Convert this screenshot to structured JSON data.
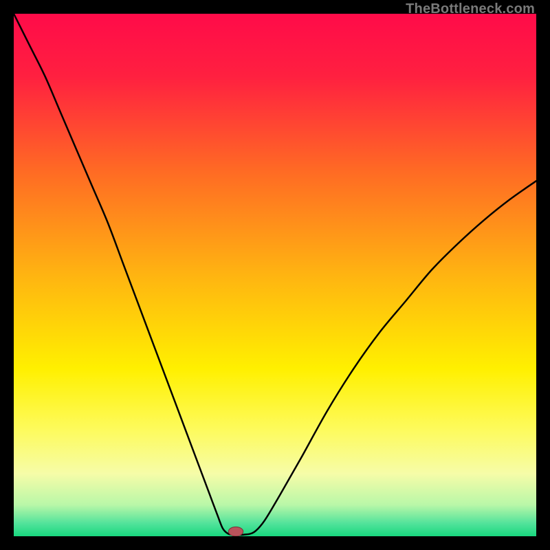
{
  "watermark": "TheBottleneck.com",
  "chart_data": {
    "type": "line",
    "title": "",
    "xlabel": "",
    "ylabel": "",
    "xlim": [
      0,
      100
    ],
    "ylim": [
      0,
      100
    ],
    "grid": false,
    "legend": false,
    "background": {
      "type": "vertical-gradient",
      "stops": [
        {
          "pos": 0.0,
          "color": "#ff0b49"
        },
        {
          "pos": 0.12,
          "color": "#ff2040"
        },
        {
          "pos": 0.3,
          "color": "#ff6a24"
        },
        {
          "pos": 0.5,
          "color": "#ffb411"
        },
        {
          "pos": 0.68,
          "color": "#fff000"
        },
        {
          "pos": 0.8,
          "color": "#fdfb60"
        },
        {
          "pos": 0.88,
          "color": "#f6fca8"
        },
        {
          "pos": 0.94,
          "color": "#b9f7a8"
        },
        {
          "pos": 0.975,
          "color": "#53e39b"
        },
        {
          "pos": 1.0,
          "color": "#18d77f"
        }
      ]
    },
    "series": [
      {
        "name": "bottleneck-curve",
        "color": "#000000",
        "stroke_width": 2.5,
        "x": [
          0,
          3,
          6,
          9,
          12,
          15,
          18,
          21,
          24,
          27,
          30,
          33,
          36,
          37.5,
          39,
          40,
          41,
          42,
          44,
          46,
          48,
          51,
          55,
          60,
          65,
          70,
          75,
          80,
          85,
          90,
          95,
          100
        ],
        "y": [
          100,
          94,
          88,
          81,
          74,
          67,
          60,
          52,
          44,
          36,
          28,
          20,
          12,
          8,
          4,
          1.5,
          0.5,
          0.3,
          0.3,
          0.8,
          3,
          8,
          15,
          24,
          32,
          39,
          45,
          51,
          56,
          60.5,
          64.5,
          68
        ]
      }
    ],
    "marker": {
      "name": "optimal-point",
      "x": 42.5,
      "y": 0.9,
      "rx": 1.4,
      "ry": 0.9,
      "fill": "#b9535b",
      "stroke": "#7a2f36"
    }
  }
}
